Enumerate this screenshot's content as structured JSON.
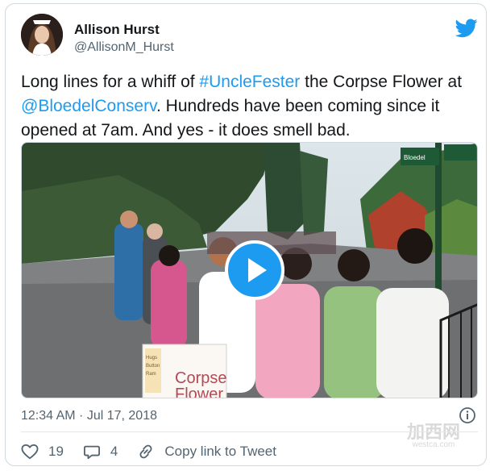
{
  "author": {
    "display_name": "Allison Hurst",
    "handle": "@AllisonM_Hurst"
  },
  "tweet": {
    "text_parts": {
      "p1": "Long lines for a whiff of ",
      "hashtag": "#UncleFester",
      "p2": " the Corpse Flower at ",
      "mention": "@BloedelConserv",
      "p3": ". Hundreds have been coming since it opened at 7am. And yes - it does smell bad."
    },
    "timestamp": "12:34 AM · Jul 17, 2018"
  },
  "media": {
    "sign_text_1": "Corpse",
    "sign_text_2": "Flower",
    "sign_small_1": "Hugs",
    "sign_small_2": "Button",
    "sign_small_3": "Ram",
    "street_sign": "Bloedel"
  },
  "actions": {
    "likes": "19",
    "replies": "4",
    "copy_link": "Copy link to Tweet"
  },
  "watermark": {
    "main": "加西网",
    "sub": "westca.com"
  },
  "colors": {
    "accent": "#1d9bf0",
    "text": "#14171a",
    "muted": "#536471"
  }
}
